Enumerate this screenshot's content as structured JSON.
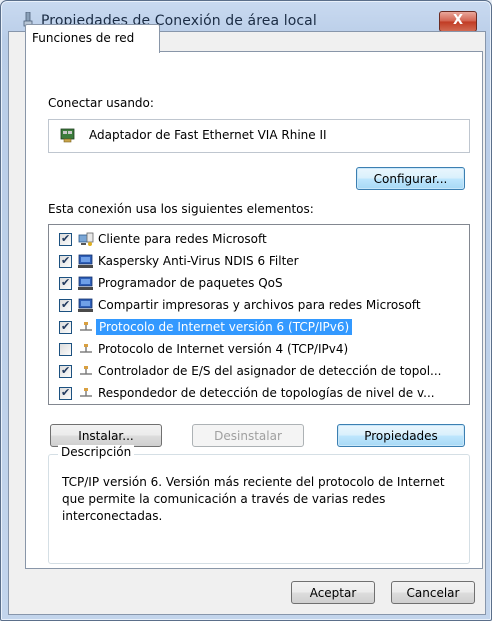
{
  "window": {
    "title": "Propiedades de Conexión de área local",
    "close_label": "X"
  },
  "tabs": [
    {
      "label": "Funciones de red"
    }
  ],
  "connect": {
    "label": "Conectar usando:",
    "adapter_name": "Adaptador de Fast Ethernet VIA Rhine II",
    "configure_button": "Configurar..."
  },
  "items_label": "Esta conexión usa los siguientes elementos:",
  "items": [
    {
      "label": "Cliente para redes Microsoft",
      "checked": true,
      "icon": "network-client-icon"
    },
    {
      "label": "Kaspersky Anti-Virus NDIS 6 Filter",
      "checked": true,
      "icon": "network-service-icon"
    },
    {
      "label": "Programador de paquetes QoS",
      "checked": true,
      "icon": "network-service-icon"
    },
    {
      "label": "Compartir impresoras y archivos para redes Microsoft",
      "checked": true,
      "icon": "network-service-icon"
    },
    {
      "label": "Protocolo de Internet versión 6 (TCP/IPv6)",
      "checked": true,
      "icon": "network-protocol-icon",
      "selected": true
    },
    {
      "label": "Protocolo de Internet versión 4 (TCP/IPv4)",
      "checked": false,
      "icon": "network-protocol-icon"
    },
    {
      "label": "Controlador de E/S del asignador de detección de topol...",
      "checked": true,
      "icon": "network-protocol-icon"
    },
    {
      "label": "Respondedor de detección de topologías de nivel de v...",
      "checked": true,
      "icon": "network-protocol-icon"
    }
  ],
  "actions": {
    "install": "Instalar...",
    "uninstall": "Desinstalar",
    "properties": "Propiedades"
  },
  "description": {
    "legend": "Descripción",
    "text": "TCP/IP versión 6. Versión más reciente del protocolo de Internet que permite la comunicación a través de varias redes interconectadas."
  },
  "footer": {
    "ok": "Aceptar",
    "cancel": "Cancelar"
  },
  "colors": {
    "selection": "#3399ff",
    "title_bar": "#c9daf0",
    "close_button": "#c03a23"
  }
}
